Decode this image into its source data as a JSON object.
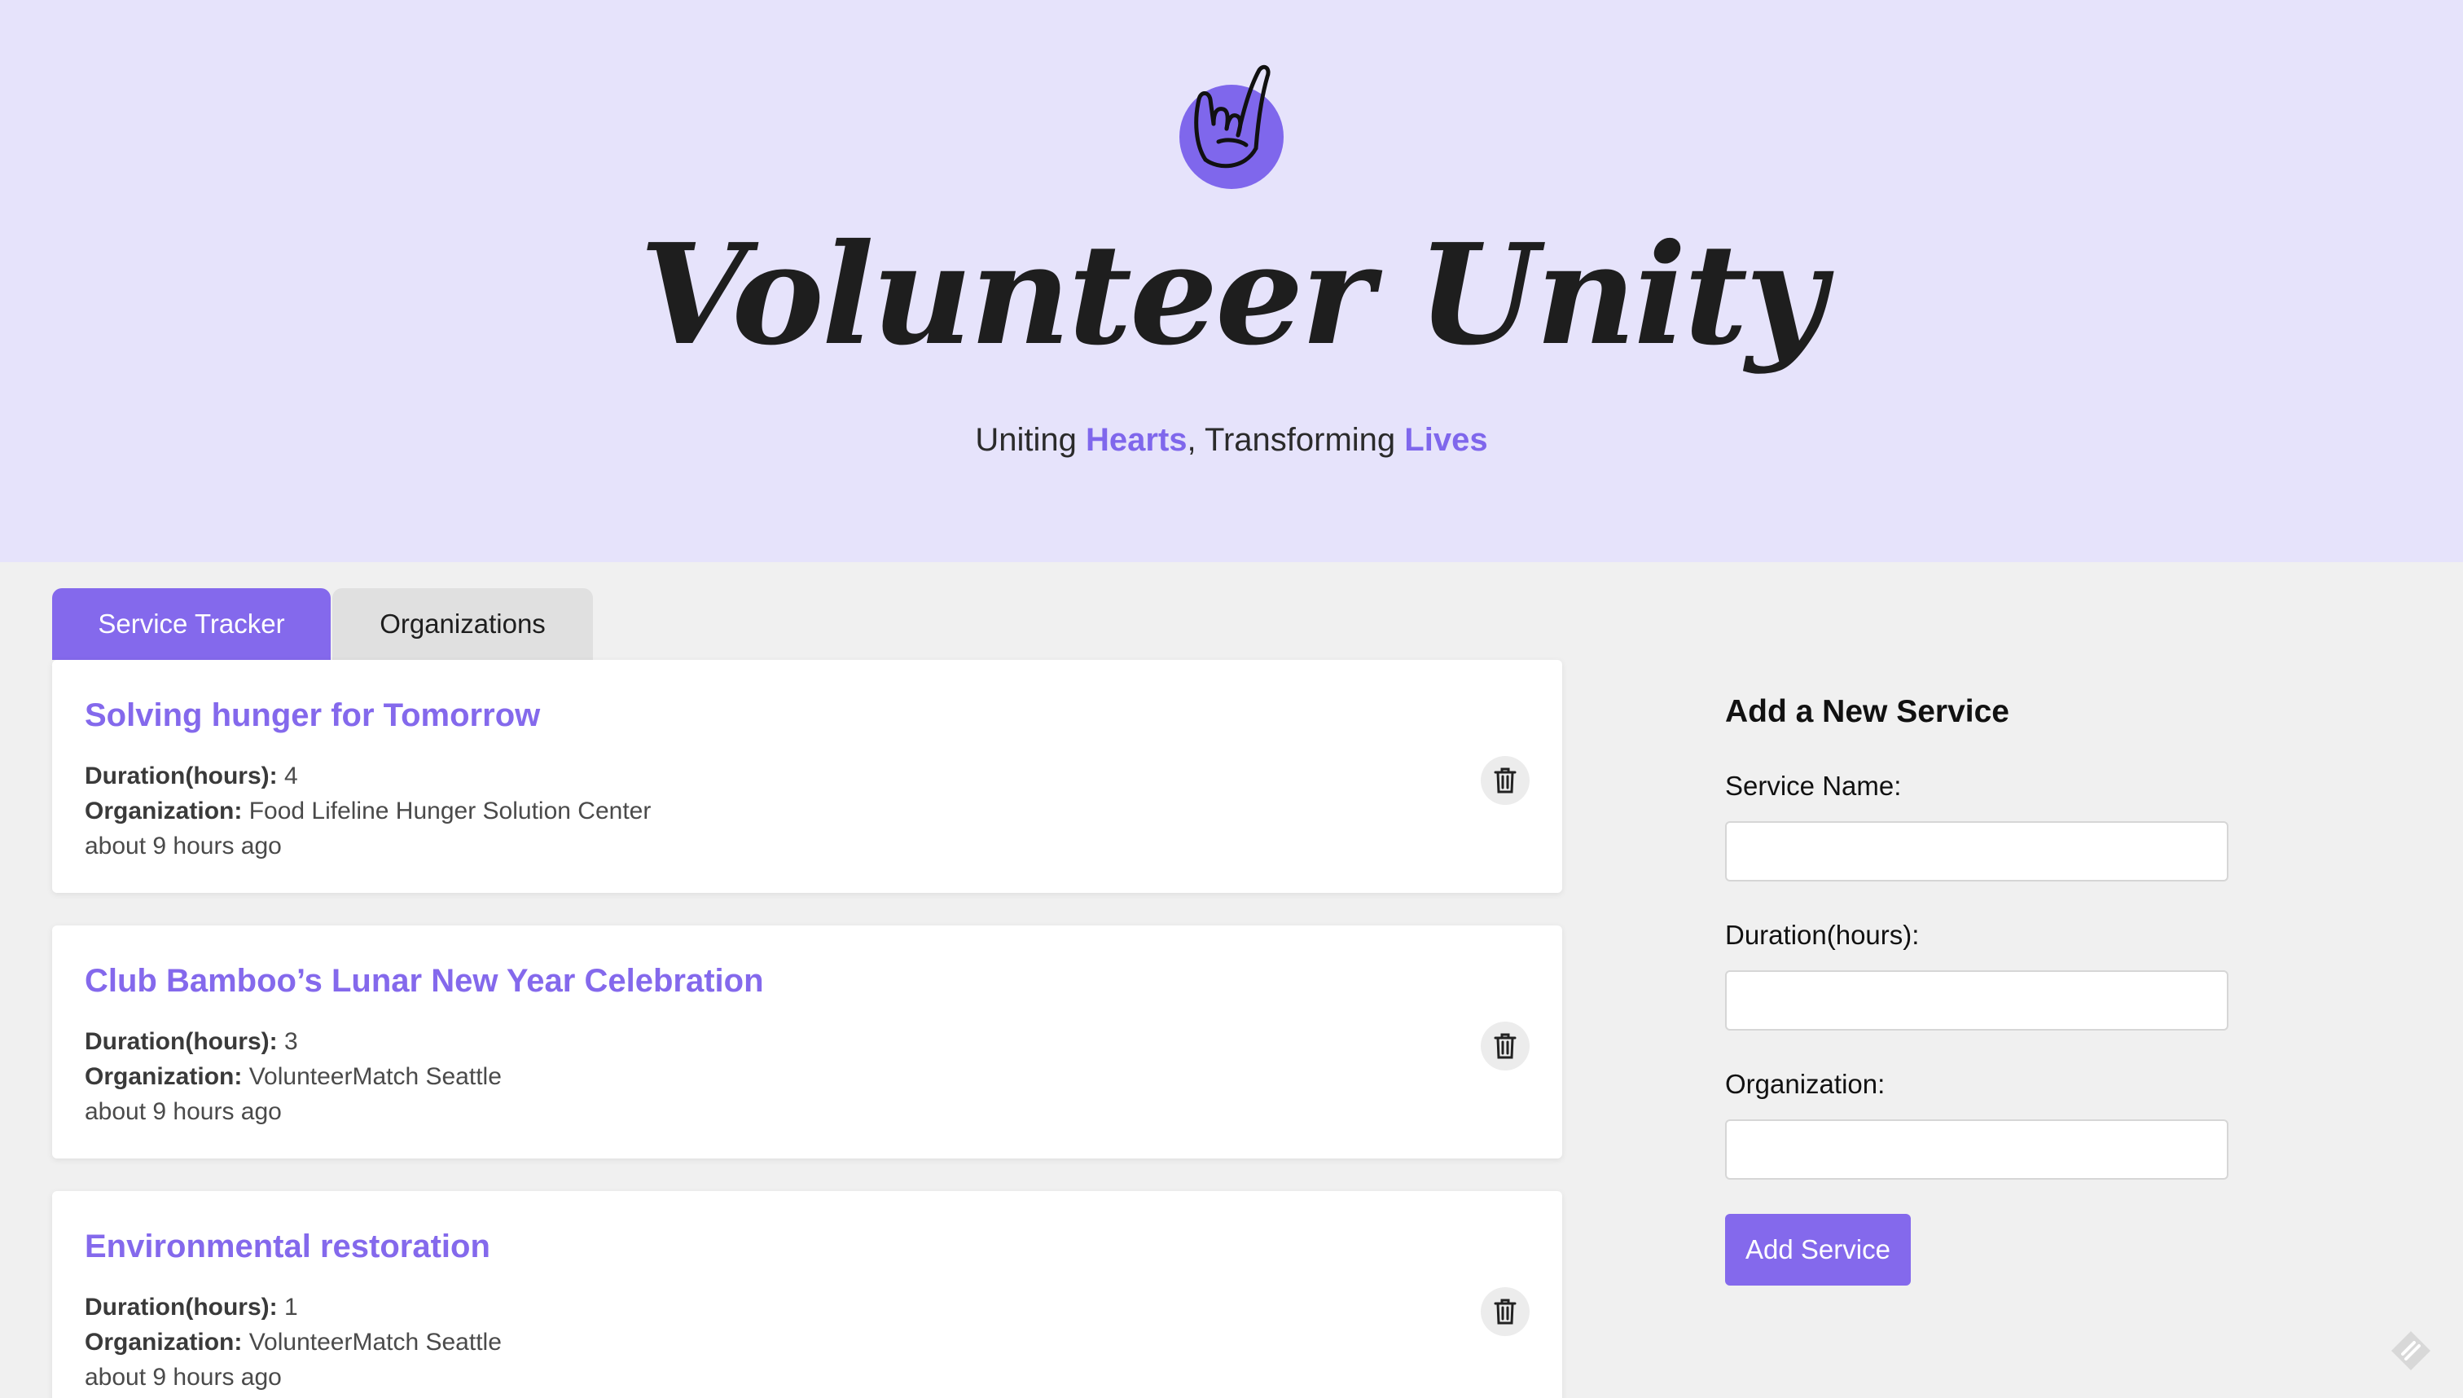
{
  "header": {
    "title": "Volunteer Unity",
    "tagline_parts": [
      "Uniting ",
      "Hearts",
      ", Transforming ",
      "Lives"
    ],
    "logo_icon": "rock-hand-icon"
  },
  "tabs": [
    {
      "label": "Service Tracker",
      "active": true
    },
    {
      "label": "Organizations",
      "active": false
    }
  ],
  "services": [
    {
      "name": "Solving hunger for Tomorrow",
      "duration_label": "Duration(hours):",
      "duration": "4",
      "organization_label": "Organization:",
      "organization": "Food Lifeline Hunger Solution Center",
      "time": "about 9 hours ago"
    },
    {
      "name": "Club Bamboo’s Lunar New Year Celebration",
      "duration_label": "Duration(hours):",
      "duration": "3",
      "organization_label": "Organization:",
      "organization": "VolunteerMatch Seattle",
      "time": "about 9 hours ago"
    },
    {
      "name": "Environmental restoration",
      "duration_label": "Duration(hours):",
      "duration": "1",
      "organization_label": "Organization:",
      "organization": "VolunteerMatch Seattle",
      "time": "about 9 hours ago"
    }
  ],
  "form": {
    "heading": "Add a New Service",
    "name_label": "Service Name:",
    "name_value": "",
    "duration_label": "Duration(hours):",
    "duration_value": "",
    "organization_label": "Organization:",
    "organization_value": "",
    "submit_label": "Add Service"
  },
  "colors": {
    "accent": "#8469ec",
    "hero_bg": "#e6e3fb",
    "page_bg": "#f0f0f0"
  }
}
